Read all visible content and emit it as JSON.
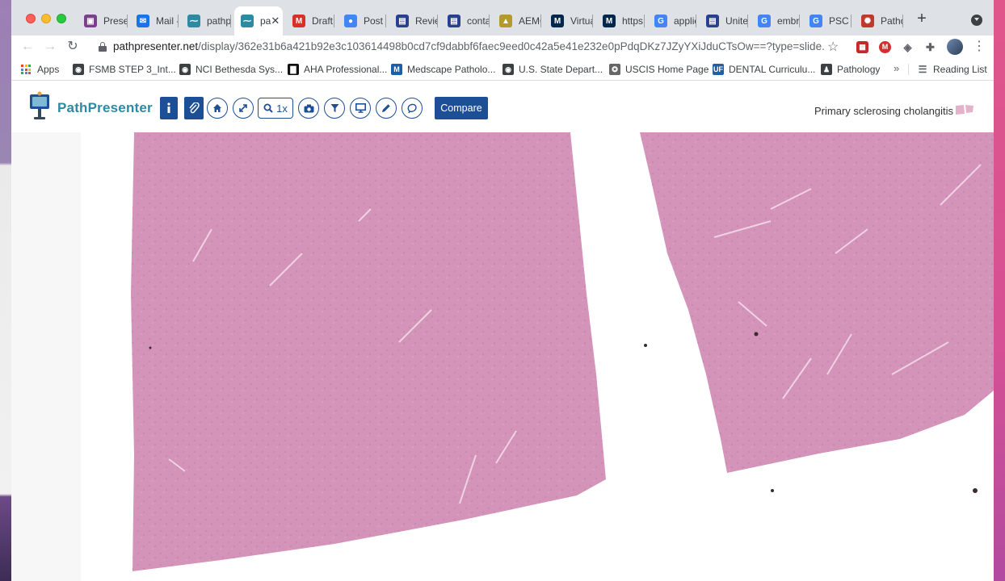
{
  "browser": {
    "tabs": [
      {
        "label": "Prese",
        "favicon_color": "#7a3f8f",
        "favicon": "▣"
      },
      {
        "label": "Mail -",
        "favicon_color": "#1a73e8",
        "favicon": "✉"
      },
      {
        "label": "pathp",
        "favicon_color": "#2c8aa3",
        "favicon": "⁓"
      },
      {
        "label": "pa",
        "favicon_color": "#2c8aa3",
        "favicon": "⁓",
        "active": true
      },
      {
        "label": "Draft",
        "favicon_color": "#d93025",
        "favicon": "M"
      },
      {
        "label": "Post a",
        "favicon_color": "#4285f4",
        "favicon": "●"
      },
      {
        "label": "Revie",
        "favicon_color": "#2b3f8f",
        "favicon": "▤"
      },
      {
        "label": "conta",
        "favicon_color": "#2b3f8f",
        "favicon": "▤"
      },
      {
        "label": "AEMC",
        "favicon_color": "#b59a2a",
        "favicon": "▲"
      },
      {
        "label": "Virtua",
        "favicon_color": "#00274c",
        "favicon": "M"
      },
      {
        "label": "https",
        "favicon_color": "#00274c",
        "favicon": "M"
      },
      {
        "label": "applic",
        "favicon_color": "#4285f4",
        "favicon": "G"
      },
      {
        "label": "Unite",
        "favicon_color": "#2b3f8f",
        "favicon": "▤"
      },
      {
        "label": "embr",
        "favicon_color": "#4285f4",
        "favicon": "G"
      },
      {
        "label": "PSC s",
        "favicon_color": "#4285f4",
        "favicon": "G"
      },
      {
        "label": "Patho",
        "favicon_color": "#c0392b",
        "favicon": "✺"
      }
    ],
    "new_tab_label": "+",
    "url_host": "pathpresenter.net",
    "url_path": "/display/362e31b6a421b92e3c103614498b0cd7cf9dabbf6faec9eed0c42a5e41e232e0pPdqDKz7JZyYXiJduCTsOw==?type=slide...",
    "nav": {
      "back": "←",
      "forward": "→",
      "reload": "↻",
      "star": "☆",
      "menu": "⋮"
    },
    "extensions": [
      {
        "label": "▦",
        "color": "#c62828"
      },
      {
        "label": "M",
        "color": "#d32f2f"
      },
      {
        "label": "◈",
        "color": "#5f6368"
      },
      {
        "label": "✚",
        "color": "#5f6368"
      }
    ]
  },
  "bookmarks": {
    "apps_label": "Apps",
    "items": [
      {
        "label": "FSMB STEP 3_Int...",
        "icon_color": "#3c4043",
        "icon": "◉"
      },
      {
        "label": "NCI Bethesda Sys...",
        "icon_color": "#3c4043",
        "icon": "◉"
      },
      {
        "label": "AHA Professional...",
        "icon_color": "#111111",
        "icon": "▇"
      },
      {
        "label": "Medscape Patholo...",
        "icon_color": "#1c5fa8",
        "icon": "M"
      },
      {
        "label": "U.S. State Depart...",
        "icon_color": "#3c4043",
        "icon": "◉"
      },
      {
        "label": "USCIS Home Page",
        "icon_color": "#666666",
        "icon": "✪"
      },
      {
        "label": "DENTAL Curriculu...",
        "icon_color": "#1f5fa8",
        "icon": "UF"
      },
      {
        "label": "Pathology",
        "icon_color": "#3c4043",
        "icon": "♟"
      }
    ],
    "more": "»",
    "reading_list": "Reading List"
  },
  "app": {
    "brand": "PathPresenter",
    "toolbar": {
      "zoom_label": "1x",
      "compare_label": "Compare"
    },
    "case_title": "Primary sclerosing cholangitis"
  },
  "colors": {
    "accent": "#1d4f96",
    "brand": "#2c8aa3",
    "tissue": "#d48fb6"
  }
}
